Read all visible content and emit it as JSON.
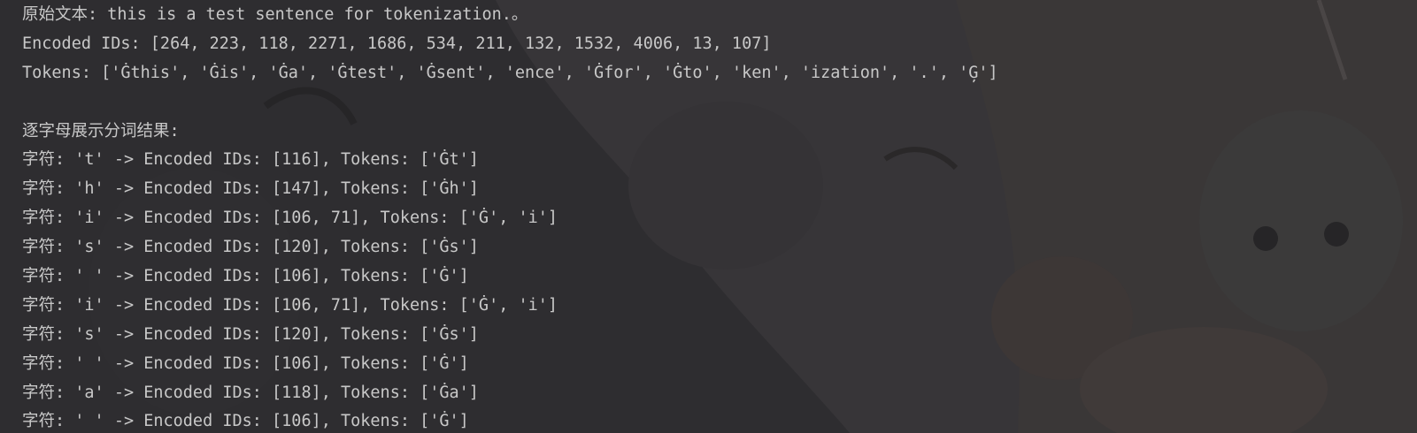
{
  "console": {
    "original_text": "原始文本: this is a test sentence for tokenization.。",
    "encoded_ids": "Encoded IDs: [264, 223, 118, 2271, 1686, 534, 211, 132, 1532, 4006, 13, 107]",
    "tokens": "Tokens: ['Ġthis', 'Ġis', 'Ġa', 'Ġtest', 'Ġsent', 'ence', 'Ġfor', 'Ġto', 'ken', 'ization', '.', 'Ģ']",
    "section_header": "逐字母展示分词结果:",
    "char_lines": [
      "字符: 't' -> Encoded IDs: [116], Tokens: ['Ġt']",
      "字符: 'h' -> Encoded IDs: [147], Tokens: ['Ġh']",
      "字符: 'i' -> Encoded IDs: [106, 71], Tokens: ['Ġ', 'i']",
      "字符: 's' -> Encoded IDs: [120], Tokens: ['Ġs']",
      "字符: ' ' -> Encoded IDs: [106], Tokens: ['Ġ']",
      "字符: 'i' -> Encoded IDs: [106, 71], Tokens: ['Ġ', 'i']",
      "字符: 's' -> Encoded IDs: [120], Tokens: ['Ġs']",
      "字符: ' ' -> Encoded IDs: [106], Tokens: ['Ġ']",
      "字符: 'a' -> Encoded IDs: [118], Tokens: ['Ġa']",
      "字符: ' ' -> Encoded IDs: [106], Tokens: ['Ġ']"
    ]
  },
  "colors": {
    "background": "#2b2b2d",
    "text": "#c8c8c8"
  }
}
